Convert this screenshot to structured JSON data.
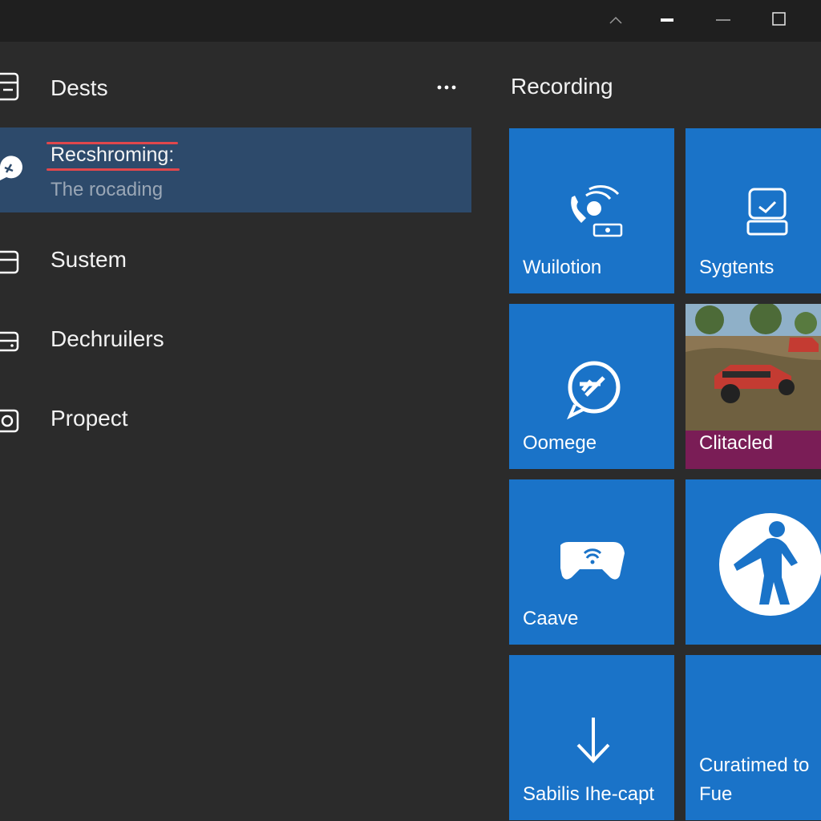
{
  "titlebar": {
    "caret_icon": "chevron-up-icon",
    "minimize_icon": "minimize-icon",
    "maximize_icon": "maximize-icon"
  },
  "nav": {
    "header_title": "Dests",
    "more_icon": "more-icon",
    "selected": {
      "title": "Recshroming:",
      "subtitle": "The rocading"
    },
    "items": [
      {
        "label": "Sustem"
      },
      {
        "label": "Dechruilers"
      },
      {
        "label": "Propect"
      }
    ]
  },
  "main": {
    "section_title": "Recording",
    "tiles": [
      {
        "label": "Wuilotion",
        "icon": "phone-signal-icon"
      },
      {
        "label": "Sygtents",
        "icon": "device-icon"
      },
      {
        "label": "Oomege",
        "icon": "chat-bubble-icon"
      },
      {
        "label": "Clitacled",
        "icon": "game-screenshot"
      },
      {
        "label": "Caave",
        "icon": "gamepad-icon"
      },
      {
        "label": "",
        "icon": "person-silhouette-icon"
      },
      {
        "label": "Sabilis Ihe-capt",
        "icon": "download-arrow-icon"
      },
      {
        "label": "Curatimed to Fue",
        "icon": ""
      }
    ]
  },
  "colors": {
    "tile_blue": "#1a73c8",
    "selection": "#2d4a6b",
    "accent_red": "#e0474c",
    "photo_bar": "#7a1d56"
  }
}
